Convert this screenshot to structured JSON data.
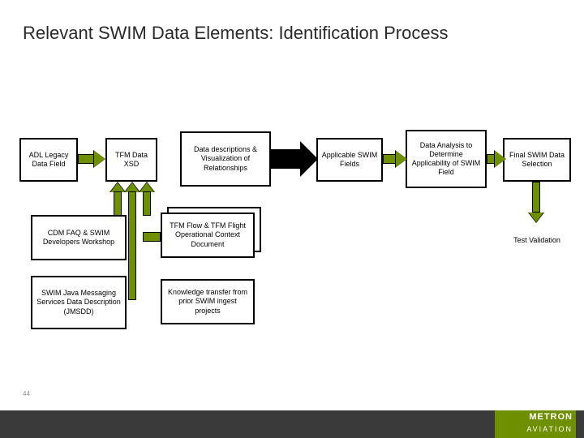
{
  "title": "Relevant SWIM Data Elements: Identification Process",
  "page_number": "44",
  "footer": {
    "brand": "METRON",
    "sub": "AVIATION"
  },
  "boxes": {
    "adl": "ADL Legacy Data Field",
    "tfm": "TFM Data XSD",
    "desc": "Data descriptions & Visualization of Relationships",
    "applic": "Applicable SWIM Fields",
    "analysis": "Data Analysis to Determine Applicability of SWIM Field",
    "final": "Final SWIM Data Selection",
    "cdm": "CDM FAQ & SWIM Developers Workshop",
    "flow": "TFM Flow & TFM Flight Operational Context Document",
    "jmsdd": "SWIM Java Messaging Services Data Description (JMSDD)",
    "know": "Knowledge transfer from prior SWIM ingest projects",
    "test": "Test Validation"
  }
}
